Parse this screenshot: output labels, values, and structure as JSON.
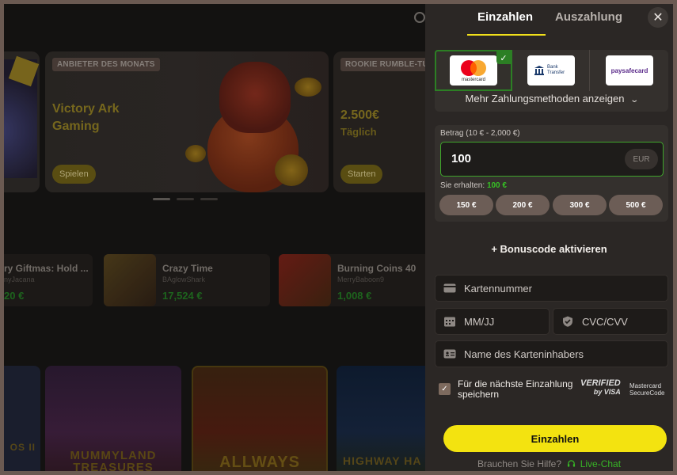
{
  "background": {
    "promos": [
      {
        "tag": "ANBIETER DES MONATS",
        "title": "Victory Ark Gaming",
        "button": "Spielen"
      },
      {
        "tag": "ROOKIE RUMBLE-TU",
        "title": "2.500€",
        "subtitle": "Täglich",
        "button": "Starten"
      }
    ],
    "games": [
      {
        "name": "ry Giftmas: Hold ...",
        "provider": "nyJacana",
        "amount": "20 €"
      },
      {
        "name": "Crazy Time",
        "provider": "BAglowShark",
        "amount": "17,524 €"
      },
      {
        "name": "Burning Coins 40",
        "provider": "MerryBaboon9",
        "amount": "1,008 €"
      }
    ],
    "tiles": [
      {
        "label": "OS II"
      },
      {
        "label": "MUMMYLAND TREASURES"
      },
      {
        "label": "ALLWAYS"
      },
      {
        "label": "HIGHWAY HA"
      }
    ]
  },
  "panel": {
    "tabs": {
      "deposit": "Einzahlen",
      "withdraw": "Auszahlung"
    },
    "close": "✕",
    "methods": [
      {
        "name": "mastercard",
        "selected": true
      },
      {
        "name": "Bank Transfer",
        "selected": false
      },
      {
        "name": "paysafecard",
        "selected": false
      }
    ],
    "more_methods": "Mehr Zahlungsmethoden anzeigen",
    "amount": {
      "label": "Betrag (10 € - 2,000 €)",
      "value": "100",
      "currency": "EUR",
      "receive_label": "Sie erhalten:",
      "receive_value": "100 €",
      "quick": [
        "150 €",
        "200 €",
        "300 €",
        "500 €"
      ]
    },
    "bonus": "+ Bonuscode aktivieren",
    "fields": {
      "card_number": "Kartennummer",
      "expiry": "MM/JJ",
      "cvc": "CVC/CVV",
      "holder": "Name des Karteninhabers"
    },
    "save": "Für die nächste Einzahlung speichern",
    "badges": {
      "visa_1": "VERIFIED",
      "visa_2": "by VISA",
      "mc_1": "Mastercard",
      "mc_2": "SecureCode"
    },
    "submit": "Einzahlen",
    "help": "Brauchen Sie Hilfe?",
    "chat": "Live-Chat"
  },
  "colors": {
    "accent": "#f3e310",
    "success": "#36c025",
    "panel": "#2b2725"
  }
}
